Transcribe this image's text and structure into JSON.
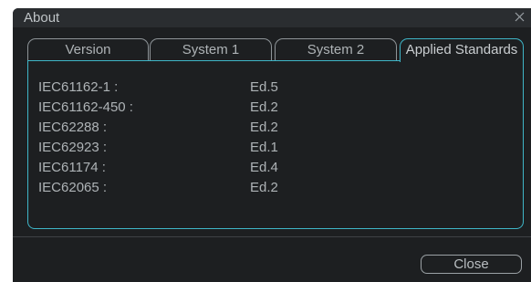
{
  "window": {
    "title": "About",
    "close_icon": "close-icon"
  },
  "tabs": [
    {
      "label": "Version",
      "active": false
    },
    {
      "label": "System 1",
      "active": false
    },
    {
      "label": "System 2",
      "active": false
    },
    {
      "label": "Applied Standards",
      "active": true
    }
  ],
  "standards": [
    {
      "standard": "IEC61162-1 :",
      "edition": "Ed.5"
    },
    {
      "standard": "IEC61162-450 :",
      "edition": "Ed.2"
    },
    {
      "standard": "IEC62288 :",
      "edition": "Ed.2"
    },
    {
      "standard": "IEC62923 :",
      "edition": "Ed.1"
    },
    {
      "standard": "IEC61174 :",
      "edition": "Ed.4"
    },
    {
      "standard": "IEC62065 :",
      "edition": "Ed.2"
    }
  ],
  "footer": {
    "close_label": "Close"
  },
  "colors": {
    "accent": "#3fb6c8",
    "background": "#1d1f21",
    "text": "#aeb3b6"
  }
}
